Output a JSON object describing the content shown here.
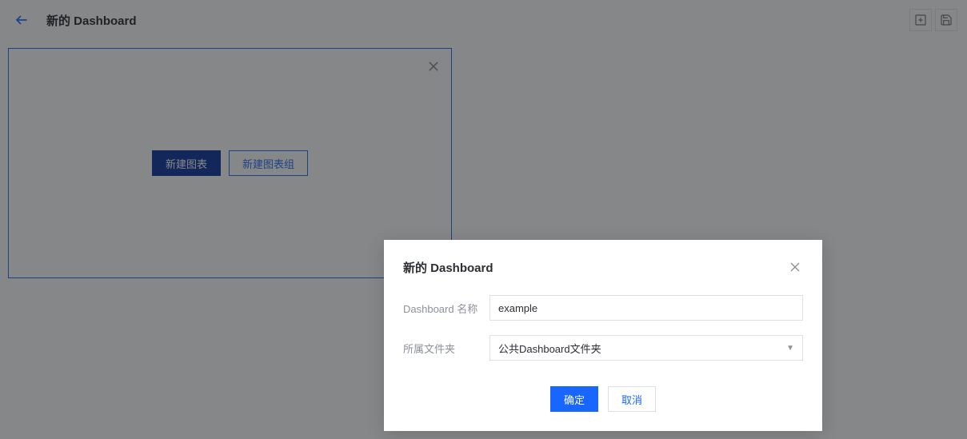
{
  "header": {
    "title": "新的 Dashboard"
  },
  "panel": {
    "new_chart": "新建图表",
    "new_chart_group": "新建图表组"
  },
  "modal": {
    "title": "新的 Dashboard",
    "name_label": "Dashboard 名称",
    "name_value": "example",
    "folder_label": "所属文件夹",
    "folder_value": "公共Dashboard文件夹",
    "confirm": "确定",
    "cancel": "取消"
  }
}
